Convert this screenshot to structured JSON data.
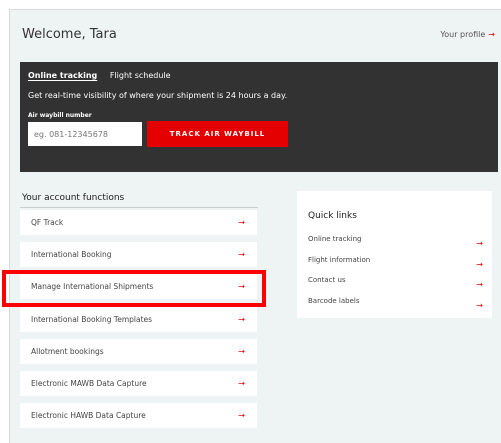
{
  "header": {
    "welcome": "Welcome, Tara",
    "profile_link": "Your profile",
    "profile_arrow": "→"
  },
  "tracking": {
    "tabs": [
      {
        "label": "Online tracking",
        "active": true
      },
      {
        "label": "Flight schedule",
        "active": false
      }
    ],
    "description": "Get real-time visibility of where your shipment is 24 hours a day.",
    "awb_label": "Air waybill number",
    "awb_placeholder": "eg. 081-12345678",
    "track_button": "TRACK AIR WAYBILL"
  },
  "account_functions": {
    "heading": "Your account functions",
    "arrow": "→",
    "items": [
      "QF Track",
      "International Booking",
      "Manage International Shipments",
      "International Booking Templates",
      "Allotment bookings",
      "Electronic MAWB Data Capture",
      "Electronic HAWB Data Capture"
    ],
    "highlighted_item": "Manage International Shipments"
  },
  "quick_links": {
    "title": "Quick links",
    "arrow": "→",
    "items": [
      "Online tracking",
      "Flight information",
      "Contact us",
      "Barcode labels"
    ]
  },
  "colors": {
    "accent": "#e40000",
    "dark_panel": "#323232",
    "page_bg": "#eef3f3",
    "highlight": "#ff0000"
  }
}
